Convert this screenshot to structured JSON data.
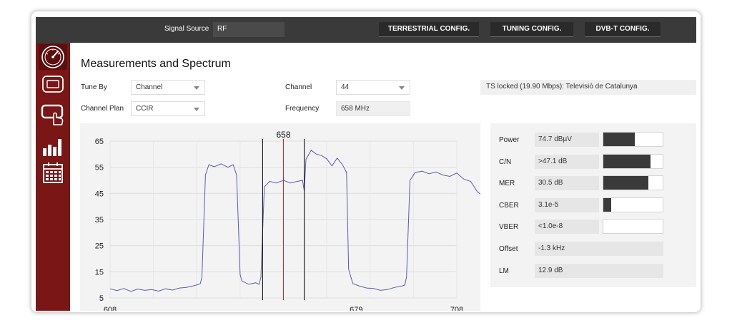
{
  "topbar": {
    "signal_source_label": "Signal Source",
    "signal_source_value": "RF",
    "buttons": [
      "TERRESTRIAL CONFIG.",
      "TUNING CONFIG.",
      "DVB-T CONFIG."
    ]
  },
  "sidebar": {
    "items": [
      "gauge",
      "tv",
      "touch-screen",
      "bar-chart",
      "calendar"
    ],
    "active_index": 0
  },
  "main": {
    "title": "Measurements and Spectrum",
    "tune_by_label": "Tune By",
    "tune_by_value": "Channel",
    "channel_plan_label": "Channel Plan",
    "channel_plan_value": "CCIR",
    "channel_label": "Channel",
    "channel_value": "44",
    "frequency_label": "Frequency",
    "frequency_value": "658 MHz",
    "status_text": "TS locked (19.90 Mbps): Televisió de Catalunya"
  },
  "measurements": [
    {
      "label": "Power",
      "value": "74.7 dBµV",
      "bar": 0.53
    },
    {
      "label": "C/N",
      "value": ">47.1 dB",
      "bar": 0.79
    },
    {
      "label": "MER",
      "value": "30.5 dB",
      "bar": 0.76
    },
    {
      "label": "CBER",
      "value": "3.1e-5",
      "bar": 0.13
    },
    {
      "label": "VBER",
      "value": "<1.0e-8",
      "bar": 0.0
    },
    {
      "label": "Offset",
      "value": "-1.3 kHz"
    },
    {
      "label": "LM",
      "value": "12.9 dB"
    }
  ],
  "chart_data": {
    "type": "line",
    "x_tick_labels": [
      "608",
      "679",
      "708"
    ],
    "y_tick_labels": [
      "65",
      "55",
      "45",
      "35",
      "25",
      "15",
      "5"
    ],
    "marker_label": "658",
    "marker_freq": 658,
    "marker_span": [
      652,
      664
    ],
    "xlim": [
      608,
      708
    ],
    "ylim": [
      5,
      65
    ],
    "grid": true,
    "series": [
      {
        "color": "#5a5ab4",
        "points": [
          [
            608,
            8.5
          ],
          [
            610,
            7.8
          ],
          [
            612,
            8.6
          ],
          [
            614,
            7.5
          ],
          [
            616,
            8.4
          ],
          [
            618,
            7.9
          ],
          [
            620,
            8.2
          ],
          [
            622,
            7.6
          ],
          [
            624,
            8.5
          ],
          [
            626,
            8.0
          ],
          [
            628,
            8.8
          ],
          [
            630,
            9.0
          ],
          [
            632,
            9.6
          ],
          [
            634,
            10.4
          ],
          [
            634.5,
            13
          ],
          [
            635.5,
            52
          ],
          [
            636.5,
            56
          ],
          [
            638,
            55.2
          ],
          [
            640,
            56.3
          ],
          [
            642,
            55
          ],
          [
            643.5,
            56
          ],
          [
            644.5,
            52
          ],
          [
            645.5,
            14
          ],
          [
            646,
            11.5
          ],
          [
            648,
            10.2
          ],
          [
            650,
            10.8
          ],
          [
            651,
            10.2
          ],
          [
            651.5,
            13
          ],
          [
            652.5,
            47.5
          ],
          [
            654,
            49.6
          ],
          [
            656,
            49
          ],
          [
            658,
            50
          ],
          [
            660,
            49
          ],
          [
            662,
            49.6
          ],
          [
            663.5,
            50
          ],
          [
            664,
            46
          ],
          [
            664.5,
            58
          ],
          [
            666,
            61.5
          ],
          [
            667.5,
            60
          ],
          [
            669,
            59.5
          ],
          [
            670.5,
            58.2
          ],
          [
            672,
            55.5
          ],
          [
            673.5,
            58.5
          ],
          [
            675,
            56
          ],
          [
            676.2,
            53
          ],
          [
            676.8,
            16
          ],
          [
            678,
            10.5
          ],
          [
            680,
            9.5
          ],
          [
            682,
            8.8
          ],
          [
            684,
            8.6
          ],
          [
            686,
            7.9
          ],
          [
            688,
            8.2
          ],
          [
            690,
            9.0
          ],
          [
            692,
            9.5
          ],
          [
            693,
            9.9
          ],
          [
            693.5,
            13
          ],
          [
            694.5,
            50
          ],
          [
            696,
            53
          ],
          [
            698,
            53.5
          ],
          [
            700,
            52.5
          ],
          [
            702,
            53.2
          ],
          [
            704,
            52
          ],
          [
            706,
            51.5
          ],
          [
            708,
            52.8
          ],
          [
            710,
            50.5
          ],
          [
            712,
            49.6
          ],
          [
            714,
            45.5
          ],
          [
            716,
            43.8
          ],
          [
            717,
            41.5
          ],
          [
            717.5,
            31.5
          ],
          [
            719,
            30.5
          ],
          [
            721,
            29.8
          ],
          [
            723,
            30.6
          ],
          [
            725,
            30
          ],
          [
            727,
            29.2
          ],
          [
            729,
            30.5
          ],
          [
            731,
            30.3
          ],
          [
            733,
            30.8
          ],
          [
            735,
            30
          ],
          [
            737,
            29.5
          ],
          [
            739,
            30.4
          ],
          [
            740,
            30.6
          ]
        ]
      }
    ]
  }
}
